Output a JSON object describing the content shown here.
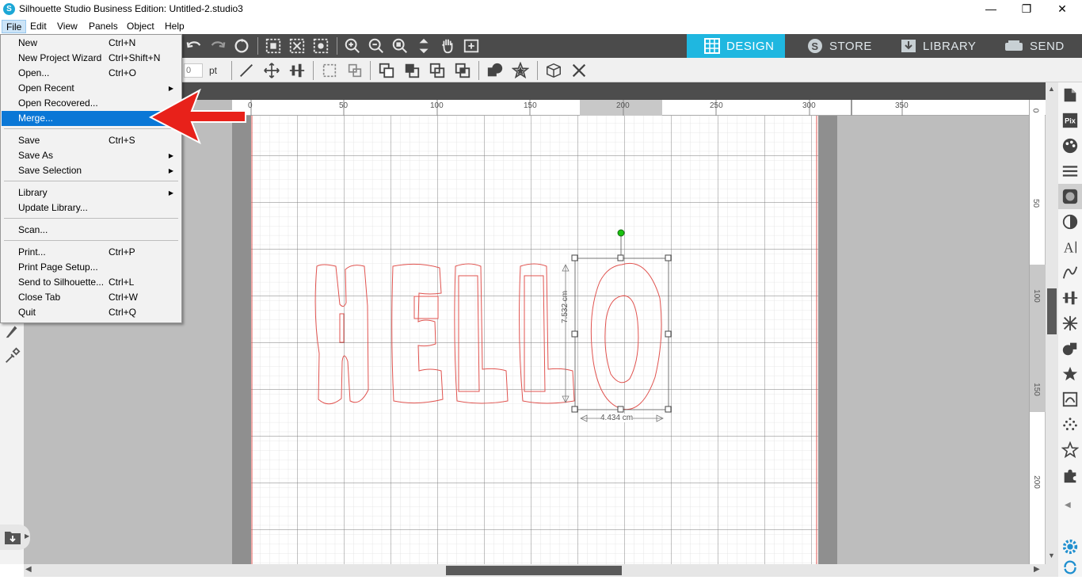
{
  "window": {
    "title": "Silhouette Studio Business Edition: Untitled-2.studio3",
    "minimize": "—",
    "restore": "❐",
    "close": "✕"
  },
  "menubar": [
    "File",
    "Edit",
    "View",
    "Panels",
    "Object",
    "Help"
  ],
  "nav_tabs": {
    "design": "DESIGN",
    "store": "STORE",
    "library": "LIBRARY",
    "send": "SEND"
  },
  "toolbar2": {
    "value_partial": "0",
    "unit": "pt"
  },
  "file_menu": [
    {
      "label": "New",
      "shortcut": "Ctrl+N"
    },
    {
      "label": "New Project Wizard",
      "shortcut": "Ctrl+Shift+N"
    },
    {
      "label": "Open...",
      "shortcut": "Ctrl+O"
    },
    {
      "label": "Open Recent",
      "shortcut": "",
      "submenu": true
    },
    {
      "label": "Open Recovered...",
      "shortcut": ""
    },
    {
      "label": "Merge...",
      "shortcut": "",
      "highlighted": true
    },
    {
      "label": "Save",
      "shortcut": "Ctrl+S"
    },
    {
      "label": "Save As",
      "shortcut": "",
      "submenu": true
    },
    {
      "label": "Save Selection",
      "shortcut": "",
      "submenu": true
    },
    {
      "label": "Library",
      "shortcut": "",
      "submenu": true
    },
    {
      "label": "Update Library...",
      "shortcut": ""
    },
    {
      "label": "Scan...",
      "shortcut": ""
    },
    {
      "label": "Print...",
      "shortcut": "Ctrl+P"
    },
    {
      "label": "Print Page Setup...",
      "shortcut": ""
    },
    {
      "label": "Send to Silhouette...",
      "shortcut": "Ctrl+L"
    },
    {
      "label": "Close Tab",
      "shortcut": "Ctrl+W"
    },
    {
      "label": "Quit",
      "shortcut": "Ctrl+Q"
    }
  ],
  "ruler_top": [
    "0",
    "50",
    "100",
    "150",
    "200",
    "250",
    "300",
    "350"
  ],
  "ruler_right": [
    "0",
    "50",
    "100",
    "150",
    "200"
  ],
  "canvas": {
    "text": "HELLO",
    "height_dim": "7.532 cm",
    "width_dim": "4.434 cm"
  },
  "colors": {
    "accent": "#1fb7e0",
    "toolbar": "#4b4b4b",
    "highlight": "#0a77d6",
    "arrow": "#e8211a",
    "cut_line": "#e0534f"
  }
}
